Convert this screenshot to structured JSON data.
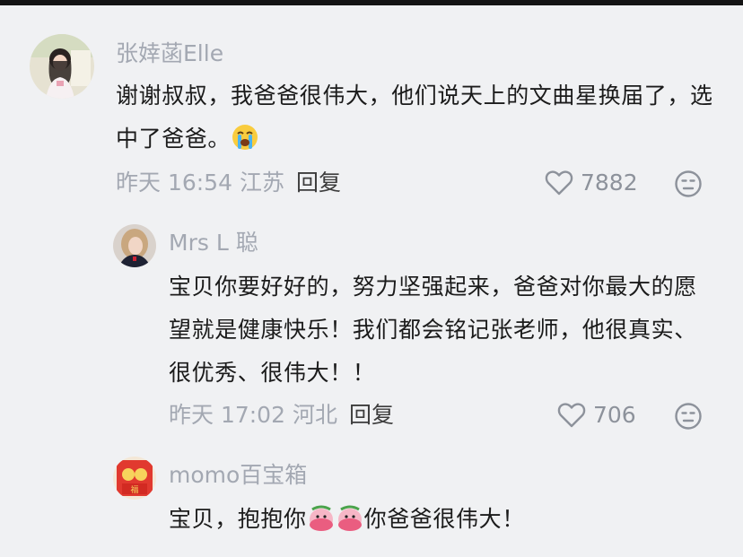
{
  "comments": [
    {
      "username": "张婞菡Elle",
      "text": "谢谢叔叔，我爸爸很伟大，他们说天上的文曲星换届了，选中了爸爸。",
      "emoji": "crying-face",
      "time": "昨天 16:54",
      "location": "江苏",
      "reply_label": "回复",
      "likes": "7882"
    },
    {
      "username": "Mrs L 聪",
      "text": "宝贝你要好好的，努力坚强起来，爸爸对你最大的愿望就是健康快乐！我们都会铭记张老师，他很真实、很优秀、很伟大！！",
      "time": "昨天 17:02",
      "location": "河北",
      "reply_label": "回复",
      "likes": "706"
    },
    {
      "username": "momo百宝箱",
      "text_before": "宝贝，抱抱你",
      "emoji": "hug-sticker",
      "text_after": "你爸爸很伟大！"
    }
  ],
  "colors": {
    "background": "#f0f1f3",
    "username": "#a3a8b2",
    "body_text": "#1b1b1b",
    "meta_text": "#a3a8b2",
    "reply": "#3c3c3c"
  },
  "icons": [
    "heart-outline-icon",
    "dislike-face-icon"
  ]
}
